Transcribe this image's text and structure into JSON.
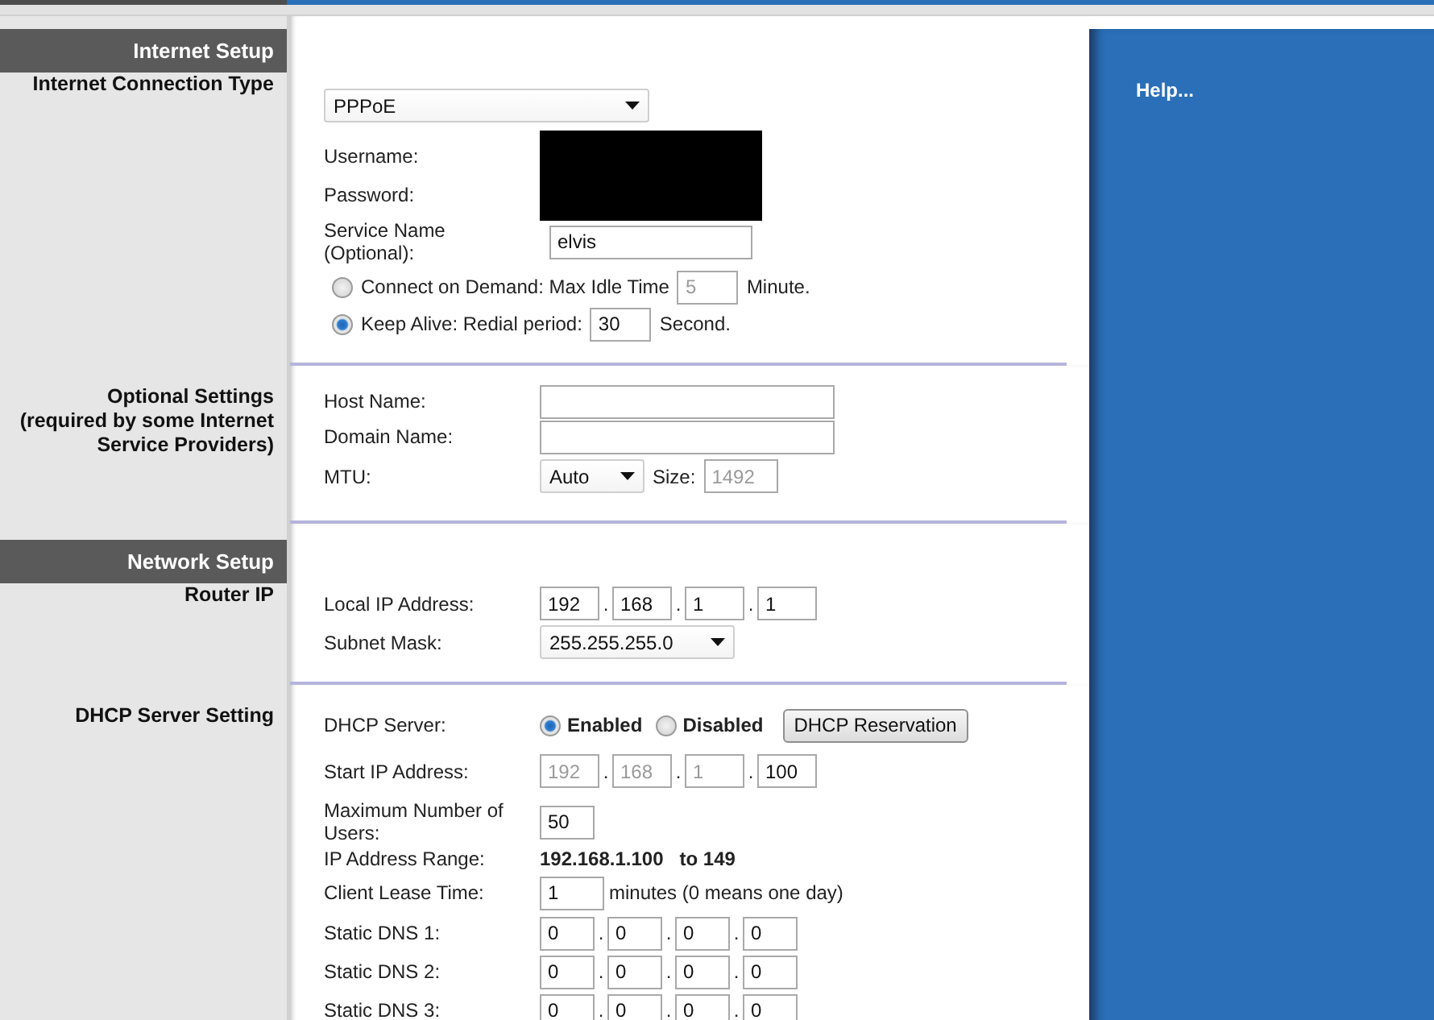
{
  "internet_setup": {
    "header": "Internet Setup",
    "label": "Internet Connection Type",
    "connection_type": {
      "value": "PPPoE"
    },
    "username_label": "Username:",
    "password_label": "Password:",
    "service_name": {
      "label_lines": [
        "Service Name",
        "(Optional):"
      ],
      "value": "elvis"
    },
    "modes": [
      {
        "label": "Connect on Demand: Max Idle Time",
        "value": "5",
        "unit": "Minute.",
        "selected": false
      },
      {
        "label": "Keep Alive: Redial period:",
        "value": "30",
        "unit": "Second.",
        "selected": true
      }
    ]
  },
  "optional_settings": {
    "label_lines": [
      "Optional Settings",
      "(required by some Internet",
      "Service Providers)"
    ],
    "host_name": {
      "label": "Host Name:"
    },
    "domain_name": {
      "label": "Domain Name:"
    },
    "mtu": {
      "label": "MTU:",
      "value": "Auto",
      "size_label": "Size:",
      "size": "1492",
      "size_disabled": true
    }
  },
  "network_setup": {
    "header": "Network Setup",
    "label": "Router IP",
    "local_ip": {
      "label": "Local IP Address:",
      "octets": [
        {
          "value": "192",
          "disabled": false
        },
        {
          "separator": ".",
          "value": "168",
          "disabled": false
        },
        {
          "separator": ".",
          "value": "1",
          "disabled": false
        },
        {
          "separator": ".",
          "value": "1",
          "disabled": false
        }
      ]
    },
    "subnet_mask": {
      "label": "Subnet Mask:",
      "value": "255.255.255.0"
    }
  },
  "dhcp": {
    "label": "DHCP Server Setting",
    "server": {
      "label": "DHCP Server:",
      "options": [
        {
          "label": "Enabled",
          "selected": true
        },
        {
          "label": "Disabled",
          "selected": false
        }
      ],
      "button": "DHCP Reservation"
    },
    "start_ip": {
      "label": "Start IP Address:",
      "octets": [
        {
          "value": "192",
          "disabled": true
        },
        {
          "separator": ".",
          "value": "168",
          "disabled": true
        },
        {
          "separator": ".",
          "value": "1",
          "disabled": true
        },
        {
          "separator": ".",
          "value": "100",
          "disabled": false
        }
      ]
    },
    "max_users": {
      "label_lines": [
        "Maximum Number of",
        "Users:"
      ],
      "value": "50"
    },
    "ip_range": {
      "label": "IP Address Range:",
      "value": "192.168.1.100   to 149"
    },
    "lease": {
      "label": "Client Lease Time:",
      "value": "1",
      "note": "minutes (0 means one day)"
    },
    "dns": [
      {
        "label": "Static DNS 1:",
        "octets": [
          {
            "value": "0",
            "disabled": false
          },
          {
            "separator": ".",
            "value": "0",
            "disabled": false
          },
          {
            "separator": ".",
            "value": "0",
            "disabled": false
          },
          {
            "separator": ".",
            "value": "0",
            "disabled": false
          }
        ]
      },
      {
        "label": "Static DNS 2:",
        "octets": [
          {
            "value": "0",
            "disabled": false
          },
          {
            "separator": ".",
            "value": "0",
            "disabled": false
          },
          {
            "separator": ".",
            "value": "0",
            "disabled": false
          },
          {
            "separator": ".",
            "value": "0",
            "disabled": false
          }
        ]
      },
      {
        "label": "Static DNS 3:",
        "octets": [
          {
            "value": "0",
            "disabled": false
          },
          {
            "separator": ".",
            "value": "0",
            "disabled": false
          },
          {
            "separator": ".",
            "value": "0",
            "disabled": false
          },
          {
            "separator": ".",
            "value": "0",
            "disabled": false
          }
        ]
      }
    ]
  },
  "help": {
    "link": "Help..."
  }
}
